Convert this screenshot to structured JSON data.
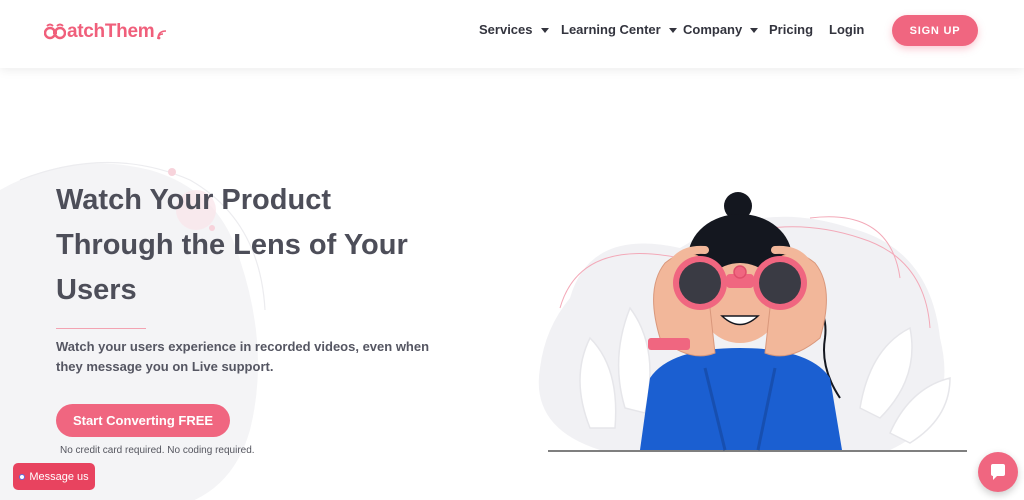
{
  "brand": {
    "name": "atchThem",
    "color": "#f05f7b",
    "logo_icon": "binoculars-eyes-icon",
    "signal_icon": "wifi-signal-icon"
  },
  "nav": {
    "items": [
      {
        "label": "Services",
        "has_dropdown": true
      },
      {
        "label": "Learning Center",
        "has_dropdown": true
      },
      {
        "label": "Company",
        "has_dropdown": true
      },
      {
        "label": "Pricing",
        "has_dropdown": false
      },
      {
        "label": "Login",
        "has_dropdown": false
      }
    ],
    "signup_label": "SIGN UP"
  },
  "hero": {
    "title": "Watch Your Product Through the Lens of Your Users",
    "subtitle": "Watch your users experience in recorded videos, even when they message you on Live support.",
    "cta_label": "Start Converting FREE",
    "cta_note": "No credit card required. No coding required.",
    "illustration_icon": "woman-with-binoculars-illustration"
  },
  "widgets": {
    "message_label": "Message us",
    "chat_icon": "chat-bubble-icon"
  },
  "colors": {
    "accent": "#f06680",
    "heading": "#4d4e59",
    "nav_text": "#33343e",
    "message_button": "#e8435f",
    "illustration_shirt": "#1b5fd1",
    "illustration_skin": "#f2b79a"
  }
}
